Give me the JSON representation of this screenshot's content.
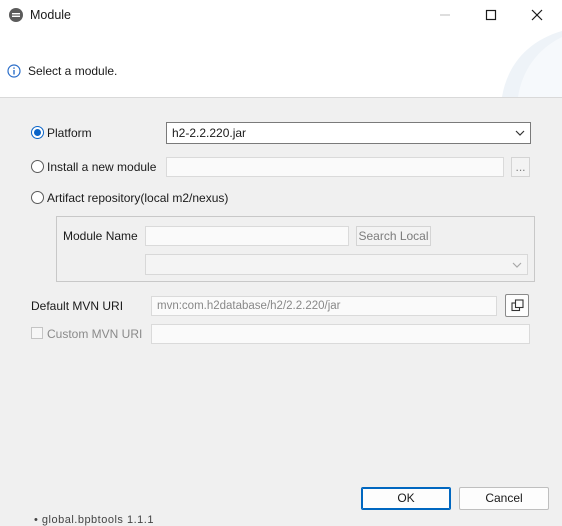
{
  "window": {
    "title": "Module",
    "app_icon": "eclipse-icon"
  },
  "banner": {
    "message": "Select a module.",
    "icon": "info-icon"
  },
  "options": {
    "platform": {
      "label": "Platform",
      "selected": true,
      "value": "h2-2.2.220.jar"
    },
    "install": {
      "label": "Install a new module",
      "selected": false,
      "value": "",
      "browse_label": "..."
    },
    "artifact": {
      "label": "Artifact repository(local m2/nexus)",
      "selected": false
    }
  },
  "artifact_group": {
    "module_name_label": "Module Name",
    "module_name_value": "",
    "search_label": "Search Local",
    "version_value": ""
  },
  "mvn": {
    "default_label": "Default MVN URI",
    "default_value": "mvn:com.h2database/h2/2.2.220/jar",
    "custom_label": "Custom MVN URI",
    "custom_checked": false,
    "custom_value": ""
  },
  "footer": {
    "ok_label": "OK",
    "cancel_label": "Cancel"
  },
  "background_peek": "• global.bpbtools 1.1.1"
}
